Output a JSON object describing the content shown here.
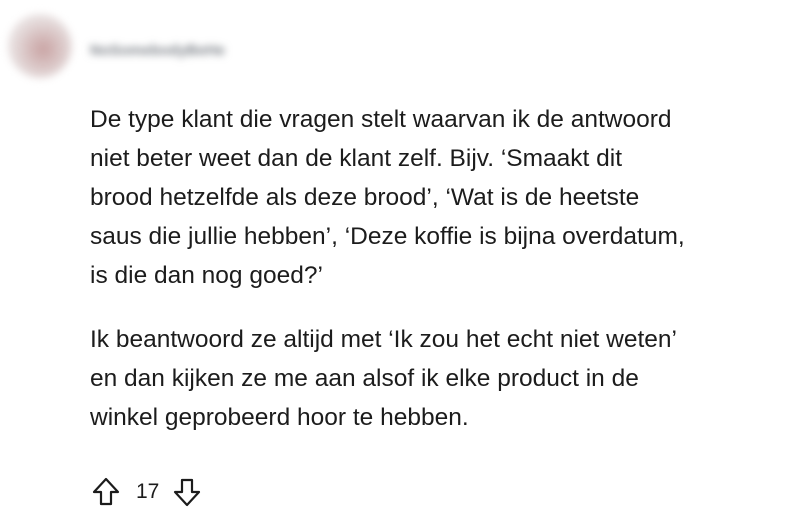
{
  "comment": {
    "username": "NoSomebodyBeHe",
    "paragraphs": [
      "De type klant die vragen stelt waarvan ik de antwoord\nniet beter weet dan de klant zelf. Bijv. ‘Smaakt dit\nbrood hetzelfde als deze brood’, ‘Wat is de heetste\nsaus die jullie hebben’, ‘Deze koffie is bijna overdatum,\nis die dan nog goed?’",
      "Ik beantwoord ze altijd met ‘Ik zou het echt niet weten’\nen dan kijken ze me aan alsof ik elke product in de\nwinkel geprobeerd hoor te hebben."
    ],
    "votes": {
      "count": "17",
      "upvote_icon": "arrow-up-outline",
      "downvote_icon": "arrow-down-outline"
    }
  }
}
